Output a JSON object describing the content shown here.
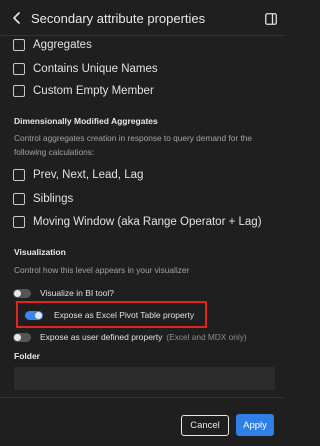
{
  "header": {
    "title": "Secondary attribute properties",
    "back_icon": "chevron-left-icon",
    "panel_icon": "panel-toggle-icon"
  },
  "aggregates": {
    "items": [
      {
        "label": "Aggregates",
        "checked": false
      },
      {
        "label": "Contains Unique Names",
        "checked": false
      },
      {
        "label": "Custom Empty Member",
        "checked": false
      }
    ]
  },
  "dimensionally_modified": {
    "title": "Dimensionally Modified Aggregates",
    "description": "Control aggregates creation in response to query demand for the following calculations:",
    "items": [
      {
        "label": "Prev, Next, Lead, Lag",
        "checked": false
      },
      {
        "label": "Siblings",
        "checked": false
      },
      {
        "label": "Moving Window (aka Range Operator + Lag)",
        "checked": false
      }
    ]
  },
  "visualization": {
    "title": "Visualization",
    "description": "Control how this level appears in your visualizer",
    "toggles": [
      {
        "label": "Visualize in BI tool?",
        "on": false,
        "hint": ""
      },
      {
        "label": "Expose as Excel Pivot Table property",
        "on": true,
        "hint": ""
      },
      {
        "label": "Expose as user defined property",
        "on": false,
        "hint": "(Excel and MDX only)"
      }
    ]
  },
  "folder": {
    "label": "Folder",
    "value": "",
    "placeholder": ""
  },
  "footer": {
    "cancel_label": "Cancel",
    "apply_label": "Apply"
  },
  "colors": {
    "background": "#1f1f1f",
    "accent": "#2f7fe6",
    "highlight": "#e02424"
  }
}
